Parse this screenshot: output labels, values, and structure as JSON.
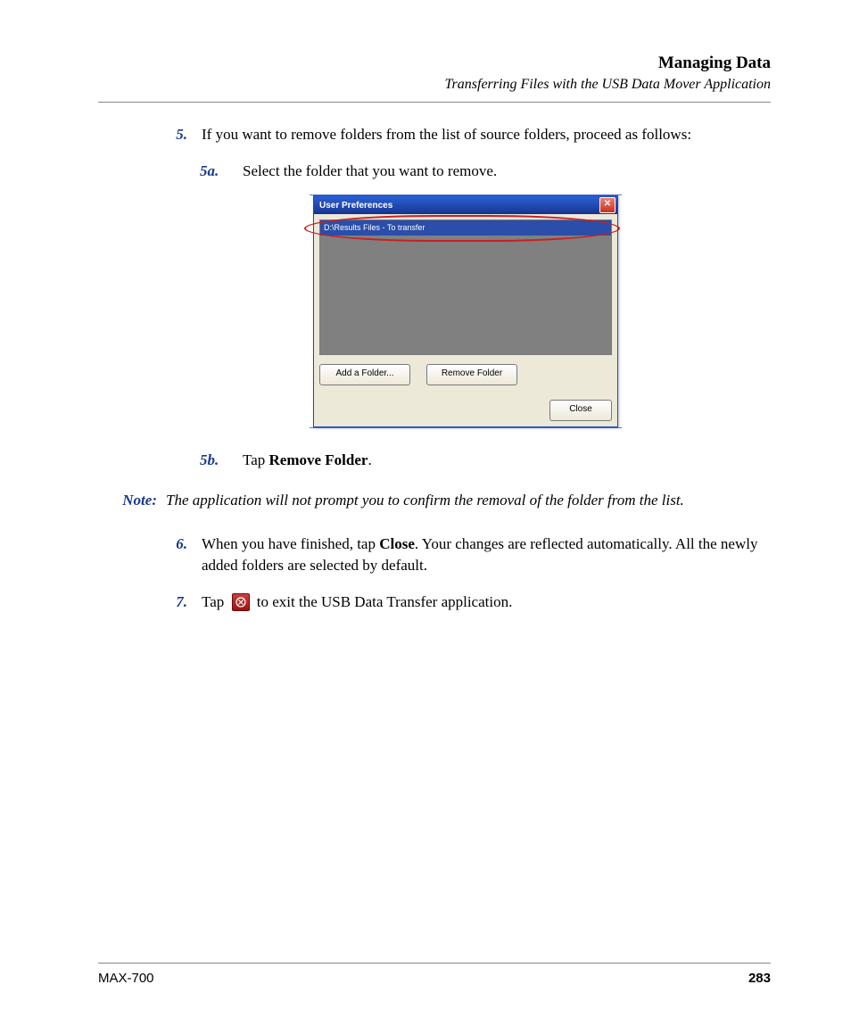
{
  "header": {
    "title": "Managing Data",
    "subtitle": "Transferring Files with the USB Data Mover Application"
  },
  "steps": {
    "s5": {
      "num": "5.",
      "text": "If you want to remove folders from the list of source folders, proceed as follows:"
    },
    "s5a": {
      "num": "5a.",
      "text": "Select the folder that you want to remove."
    },
    "s5b": {
      "num": "5b.",
      "prefix": "Tap ",
      "bold": "Remove Folder",
      "suffix": "."
    },
    "s6": {
      "num": "6.",
      "prefix": "When you have finished, tap ",
      "bold": "Close",
      "suffix": ". Your changes are reflected automatically. All the newly added folders are selected by default."
    },
    "s7": {
      "num": "7.",
      "prefix": "Tap ",
      "suffix": " to exit the USB Data Transfer application."
    }
  },
  "note": {
    "label": "Note:",
    "text": "The application will not prompt you to confirm the removal of the folder from the list."
  },
  "dialog": {
    "title": "User Preferences",
    "closeX": "✕",
    "listItem": "D:\\Results Files - To transfer",
    "addBtn": "Add a Folder...",
    "removeBtn": "Remove Folder",
    "closeBtn": "Close"
  },
  "footer": {
    "left": "MAX-700",
    "right": "283"
  }
}
